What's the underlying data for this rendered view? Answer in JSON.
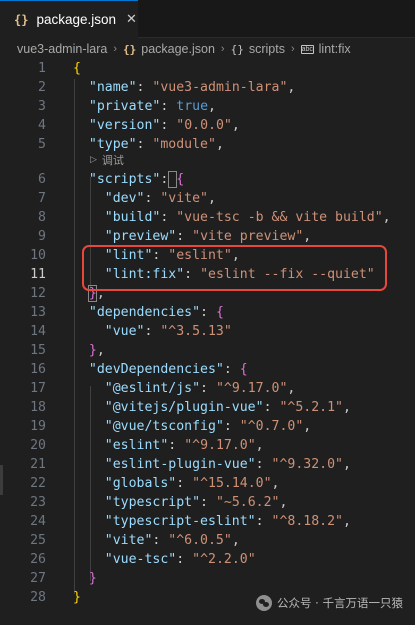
{
  "tab": {
    "icon": "{}",
    "label": "package.json",
    "close": "✕"
  },
  "breadcrumb": {
    "folder": "vue3-admin-lara",
    "json_icon": "{}",
    "file": "package.json",
    "obj_icon": "{}",
    "scripts": "scripts",
    "str_icon": "abc",
    "current": "lint:fix",
    "sep": "›"
  },
  "editor": {
    "line_numbers": [
      "1",
      "2",
      "3",
      "4",
      "5",
      "6",
      "7",
      "8",
      "9",
      "10",
      "11",
      "12",
      "13",
      "14",
      "15",
      "16",
      "17",
      "18",
      "19",
      "20",
      "21",
      "22",
      "23",
      "24",
      "25",
      "26",
      "27",
      "28"
    ],
    "active_line": "11",
    "codelens": "调试",
    "accent_highlight": "#e8473b"
  },
  "watermark": {
    "text": "公众号 · 千言万语一只猿"
  },
  "colors": {
    "key": "#9cdcfe",
    "string": "#ce9178",
    "boolean": "#569cd6"
  }
}
